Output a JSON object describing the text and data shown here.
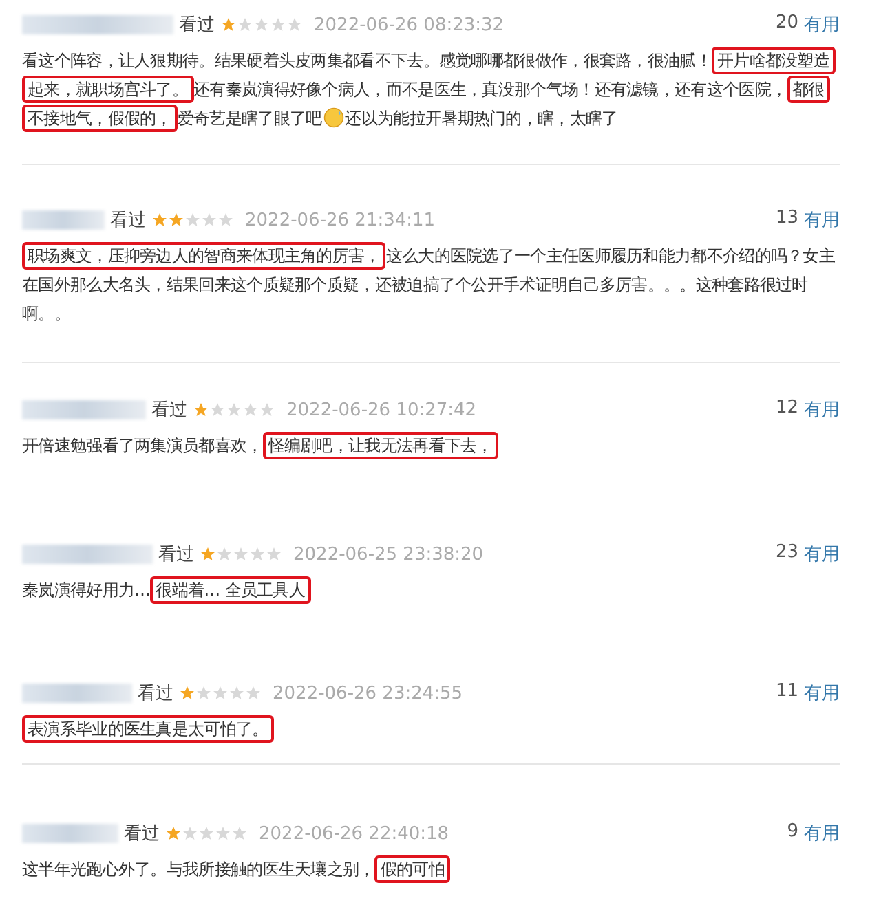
{
  "reviews": [
    {
      "status": "看过",
      "stars": 1,
      "time": "2022-06-26 08:23:32",
      "votes": "20",
      "vote_label": "有用",
      "segments": [
        {
          "kind": "text",
          "text": "看这个阵容，让人狠期待。结果硬着头皮两集都看不下去。感觉哪哪都很做作，很套路，很油腻！",
          "highlighted": false
        },
        {
          "kind": "text",
          "text": "开片啥都没塑造起来，就职场宫斗了。",
          "highlighted": true
        },
        {
          "kind": "text",
          "text": "还有秦岚演得好像个病人，而不是医生，真没那个气场！还有滤镜，还有这个医院，",
          "highlighted": false
        },
        {
          "kind": "text",
          "text": "都很不接地气，假假的，",
          "highlighted": true
        },
        {
          "kind": "text",
          "text": "爱奇艺是瞎了眼了吧",
          "highlighted": false
        },
        {
          "kind": "emoji"
        },
        {
          "kind": "text",
          "text": "还以为能拉开暑期热门的，瞎，太瞎了",
          "highlighted": false
        }
      ]
    },
    {
      "status": "看过",
      "stars": 2,
      "time": "2022-06-26 21:34:11",
      "votes": "13",
      "vote_label": "有用",
      "segments": [
        {
          "kind": "text",
          "text": "职场爽文，压抑旁边人的智商来体现主角的厉害，",
          "highlighted": true
        },
        {
          "kind": "text",
          "text": "这么大的医院选了一个主任医师履历和能力都不介绍的吗？女主在国外那么大名头，结果回来这个质疑那个质疑，还被迫搞了个公开手术证明自己多厉害。。。这种套路很过时啊。。",
          "highlighted": false
        }
      ]
    },
    {
      "status": "看过",
      "stars": 1,
      "time": "2022-06-26 10:27:42",
      "votes": "12",
      "vote_label": "有用",
      "segments": [
        {
          "kind": "text",
          "text": "开倍速勉强看了两集演员都喜欢，",
          "highlighted": false
        },
        {
          "kind": "text",
          "text": "怪编剧吧，让我无法再看下去，",
          "highlighted": true
        }
      ]
    },
    {
      "status": "看过",
      "stars": 1,
      "time": "2022-06-25 23:38:20",
      "votes": "23",
      "vote_label": "有用",
      "segments": [
        {
          "kind": "text",
          "text": "秦岚演得好用力…",
          "highlighted": false
        },
        {
          "kind": "text",
          "text": "很端着… 全员工具人",
          "highlighted": true
        }
      ]
    },
    {
      "status": "看过",
      "stars": 1,
      "time": "2022-06-26 23:24:55",
      "votes": "11",
      "vote_label": "有用",
      "segments": [
        {
          "kind": "text",
          "text": "表演系毕业的医生真是太可怕了。",
          "highlighted": true
        }
      ]
    },
    {
      "status": "看过",
      "stars": 1,
      "time": "2022-06-26 22:40:18",
      "votes": "9",
      "vote_label": "有用",
      "segments": [
        {
          "kind": "text",
          "text": "这半年光跑心外了。与我所接触的医生天壤之别，",
          "highlighted": false
        },
        {
          "kind": "text",
          "text": "假的可怕",
          "highlighted": true
        }
      ]
    }
  ]
}
